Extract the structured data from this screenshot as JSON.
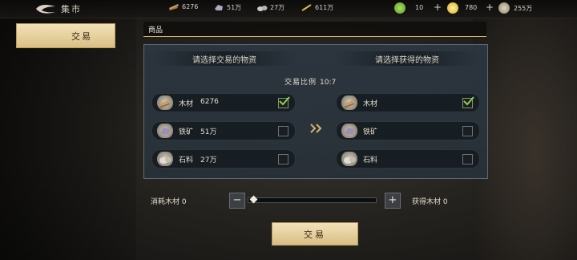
{
  "header": {
    "title": "集市",
    "resources": [
      {
        "icon": "wood-icon",
        "value": "6276"
      },
      {
        "icon": "iron-ore-icon",
        "value": "51万"
      },
      {
        "icon": "stone-icon",
        "value": "27万"
      },
      {
        "icon": "grain-icon",
        "value": "611万"
      }
    ],
    "currencies": [
      {
        "icon": "jade-coin-icon",
        "value": "10",
        "color": "#7fb640"
      },
      {
        "icon": "gold-coin-icon",
        "value": "780",
        "color": "#e8c23a"
      },
      {
        "icon": "copper-coin-icon",
        "value": "255万",
        "color": "#a89a7c"
      }
    ]
  },
  "sidebar": {
    "tab_label": "交易"
  },
  "goods_label": "商品",
  "panel": {
    "left_header": "请选择交易的物资",
    "right_header": "请选择获得的物资",
    "ratio_label": "交易比例",
    "ratio_value": "10:7",
    "left_items": [
      {
        "icon": "wood-icon",
        "label": "木材",
        "amount": "6276",
        "checked": true
      },
      {
        "icon": "iron-ore-icon",
        "label": "铁矿",
        "amount": "51万",
        "checked": false
      },
      {
        "icon": "stone-icon",
        "label": "石料",
        "amount": "27万",
        "checked": false
      }
    ],
    "right_items": [
      {
        "icon": "wood-icon",
        "label": "木材",
        "checked": true
      },
      {
        "icon": "iron-ore-icon",
        "label": "铁矿",
        "checked": false
      },
      {
        "icon": "stone-icon",
        "label": "石料",
        "checked": false
      }
    ]
  },
  "exchange": {
    "consume_label": "消耗木材 0",
    "obtain_label": "获得木材 0",
    "minus": "−",
    "plus": "+",
    "slider_value": 0
  },
  "trade_button": "交易",
  "colors": {
    "accent_gold": "#d6b46a",
    "check_green": "#8ed04a"
  }
}
